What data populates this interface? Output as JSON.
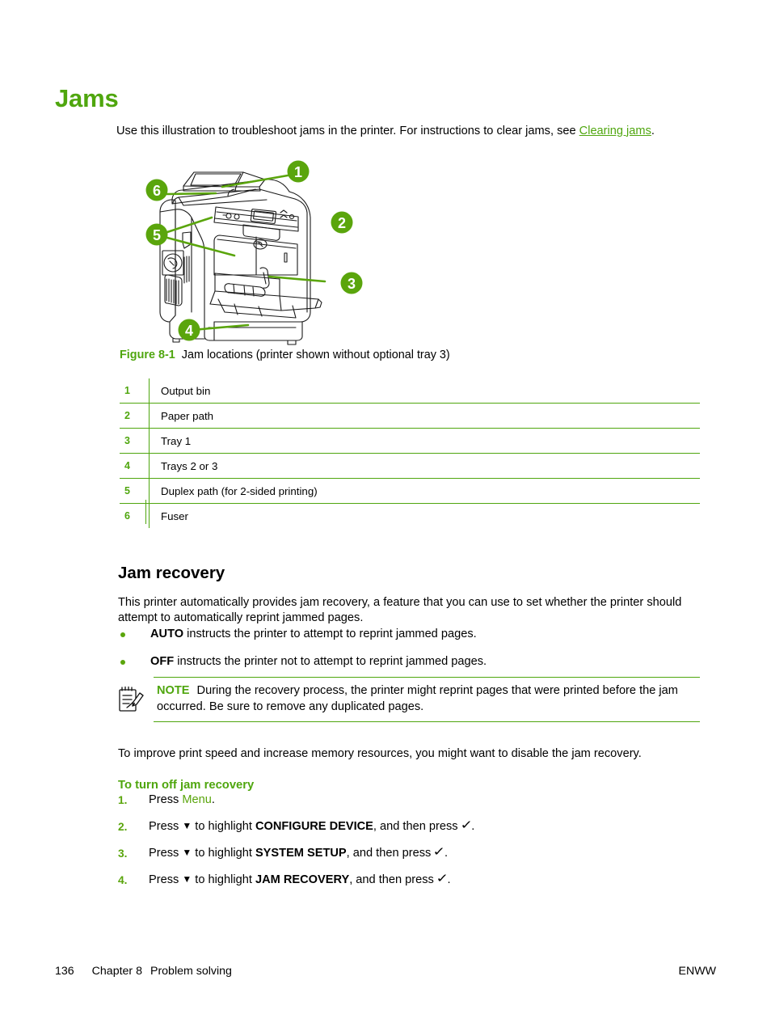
{
  "page": {
    "title": "Jams",
    "intro_before": "Use this illustration to troubleshoot jams in the printer. For instructions to clear jams, see ",
    "intro_link": "Clearing jams",
    "intro_after": "."
  },
  "figure": {
    "number_label": "Figure 8-1",
    "caption": "Jam locations (printer shown without optional tray 3)",
    "callouts": [
      "1",
      "2",
      "3",
      "4",
      "5",
      "6"
    ],
    "alt": "Line drawing of a color laser printer with six numbered callouts",
    "accent_color": "#5aa50c",
    "line_color": "#1a1a1a"
  },
  "callout_table": {
    "rows": [
      {
        "num": "1",
        "label": "Output bin"
      },
      {
        "num": "2",
        "label": "Paper path"
      },
      {
        "num": "3",
        "label": "Tray 1"
      },
      {
        "num": "4",
        "label": "Trays 2 or 3"
      },
      {
        "num": "5",
        "label": "Duplex path (for 2-sided printing)"
      },
      {
        "num": "6",
        "label": "Fuser"
      }
    ]
  },
  "jam_recovery": {
    "heading": "Jam recovery",
    "paragraph": "This printer automatically provides jam recovery, a feature that you can use to set whether the printer should attempt to automatically reprint jammed pages.",
    "bullets": [
      {
        "bold": "AUTO",
        "rest": " instructs the printer to attempt to reprint jammed pages."
      },
      {
        "bold": "OFF",
        "rest": " instructs the printer not to attempt to reprint jammed pages."
      }
    ],
    "note": {
      "label": "NOTE",
      "icon": "note-pencil-icon",
      "text": "During the recovery process, the printer might reprint pages that were printed before the jam occurred. Be sure to remove any duplicated pages."
    },
    "improve_paragraph": "To improve print speed and increase memory resources, you might want to disable the jam recovery."
  },
  "procedure": {
    "heading": "To turn off jam recovery",
    "steps": [
      {
        "num": "1.",
        "pre": "Press ",
        "menu_word": "Menu",
        "has_arrow": false,
        "mid": "",
        "bold": "",
        "post": "."
      },
      {
        "num": "2.",
        "pre": "Press ",
        "menu_word": "",
        "has_arrow": true,
        "mid": " to highlight ",
        "bold": "CONFIGURE DEVICE",
        "post": ", and then press "
      },
      {
        "num": "3.",
        "pre": "Press ",
        "menu_word": "",
        "has_arrow": true,
        "mid": " to highlight ",
        "bold": "SYSTEM SETUP",
        "post": ", and then press "
      },
      {
        "num": "4.",
        "pre": "Press ",
        "menu_word": "",
        "has_arrow": true,
        "mid": " to highlight ",
        "bold": "JAM RECOVERY",
        "post": ", and then press "
      }
    ],
    "down_arrow_glyph": "▼",
    "check_glyph": "✓",
    "period": "."
  },
  "footer": {
    "page_number": "136",
    "chapter": "Chapter 8",
    "section": "Problem solving",
    "right": "ENWW"
  },
  "colors": {
    "heading_green": "#4fa60e",
    "accent_green": "#5aa50c",
    "rule_green": "#4fa60e",
    "text_black": "#000000"
  }
}
